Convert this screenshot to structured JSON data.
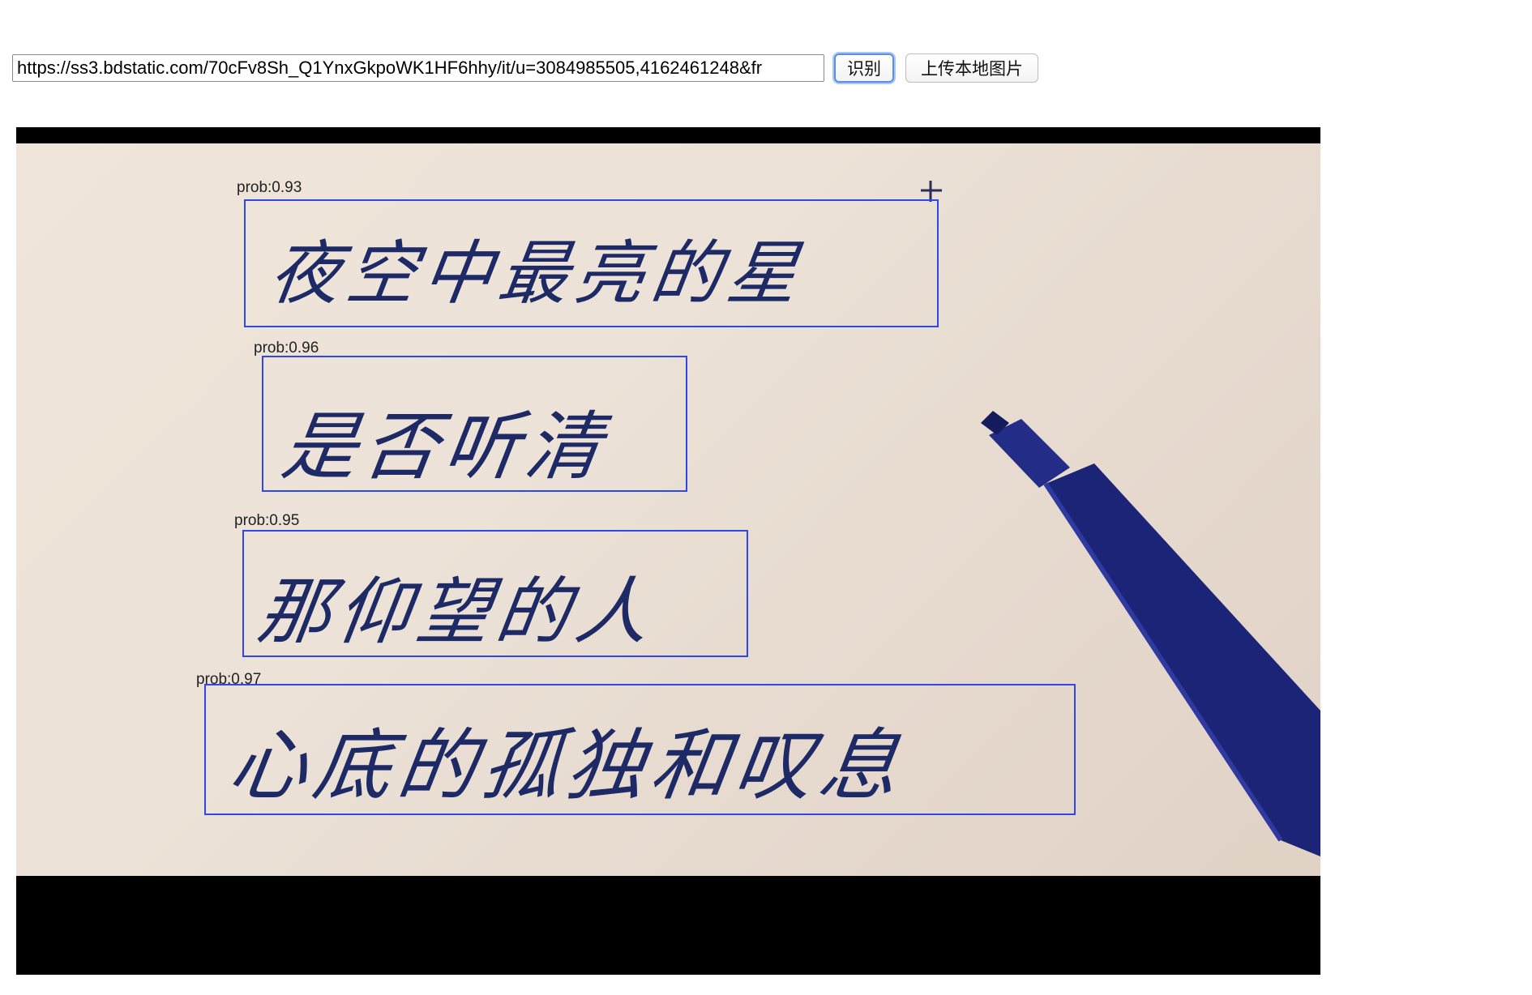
{
  "toolbar": {
    "url_value": "https://ss3.bdstatic.com/70cFv8Sh_Q1YnxGkpoWK1HF6hhy/it/u=3084985505,4162461248&fr",
    "recognize_label": "识别",
    "upload_label": "上传本地图片"
  },
  "detections": [
    {
      "prob": "prob:0.93",
      "text": "夜空中最亮的星"
    },
    {
      "prob": "prob:0.96",
      "text": "是否听清"
    },
    {
      "prob": "prob:0.95",
      "text": "那仰望的人"
    },
    {
      "prob": "prob:0.97",
      "text": "心底的孤独和叹息"
    }
  ],
  "colors": {
    "box": "#2f47e6",
    "ink": "#1e2a66",
    "pen": "#1c2478",
    "frame": "#000000"
  },
  "icons": {
    "pen": "marker-pen-icon",
    "plus": "plus-mark-icon"
  }
}
